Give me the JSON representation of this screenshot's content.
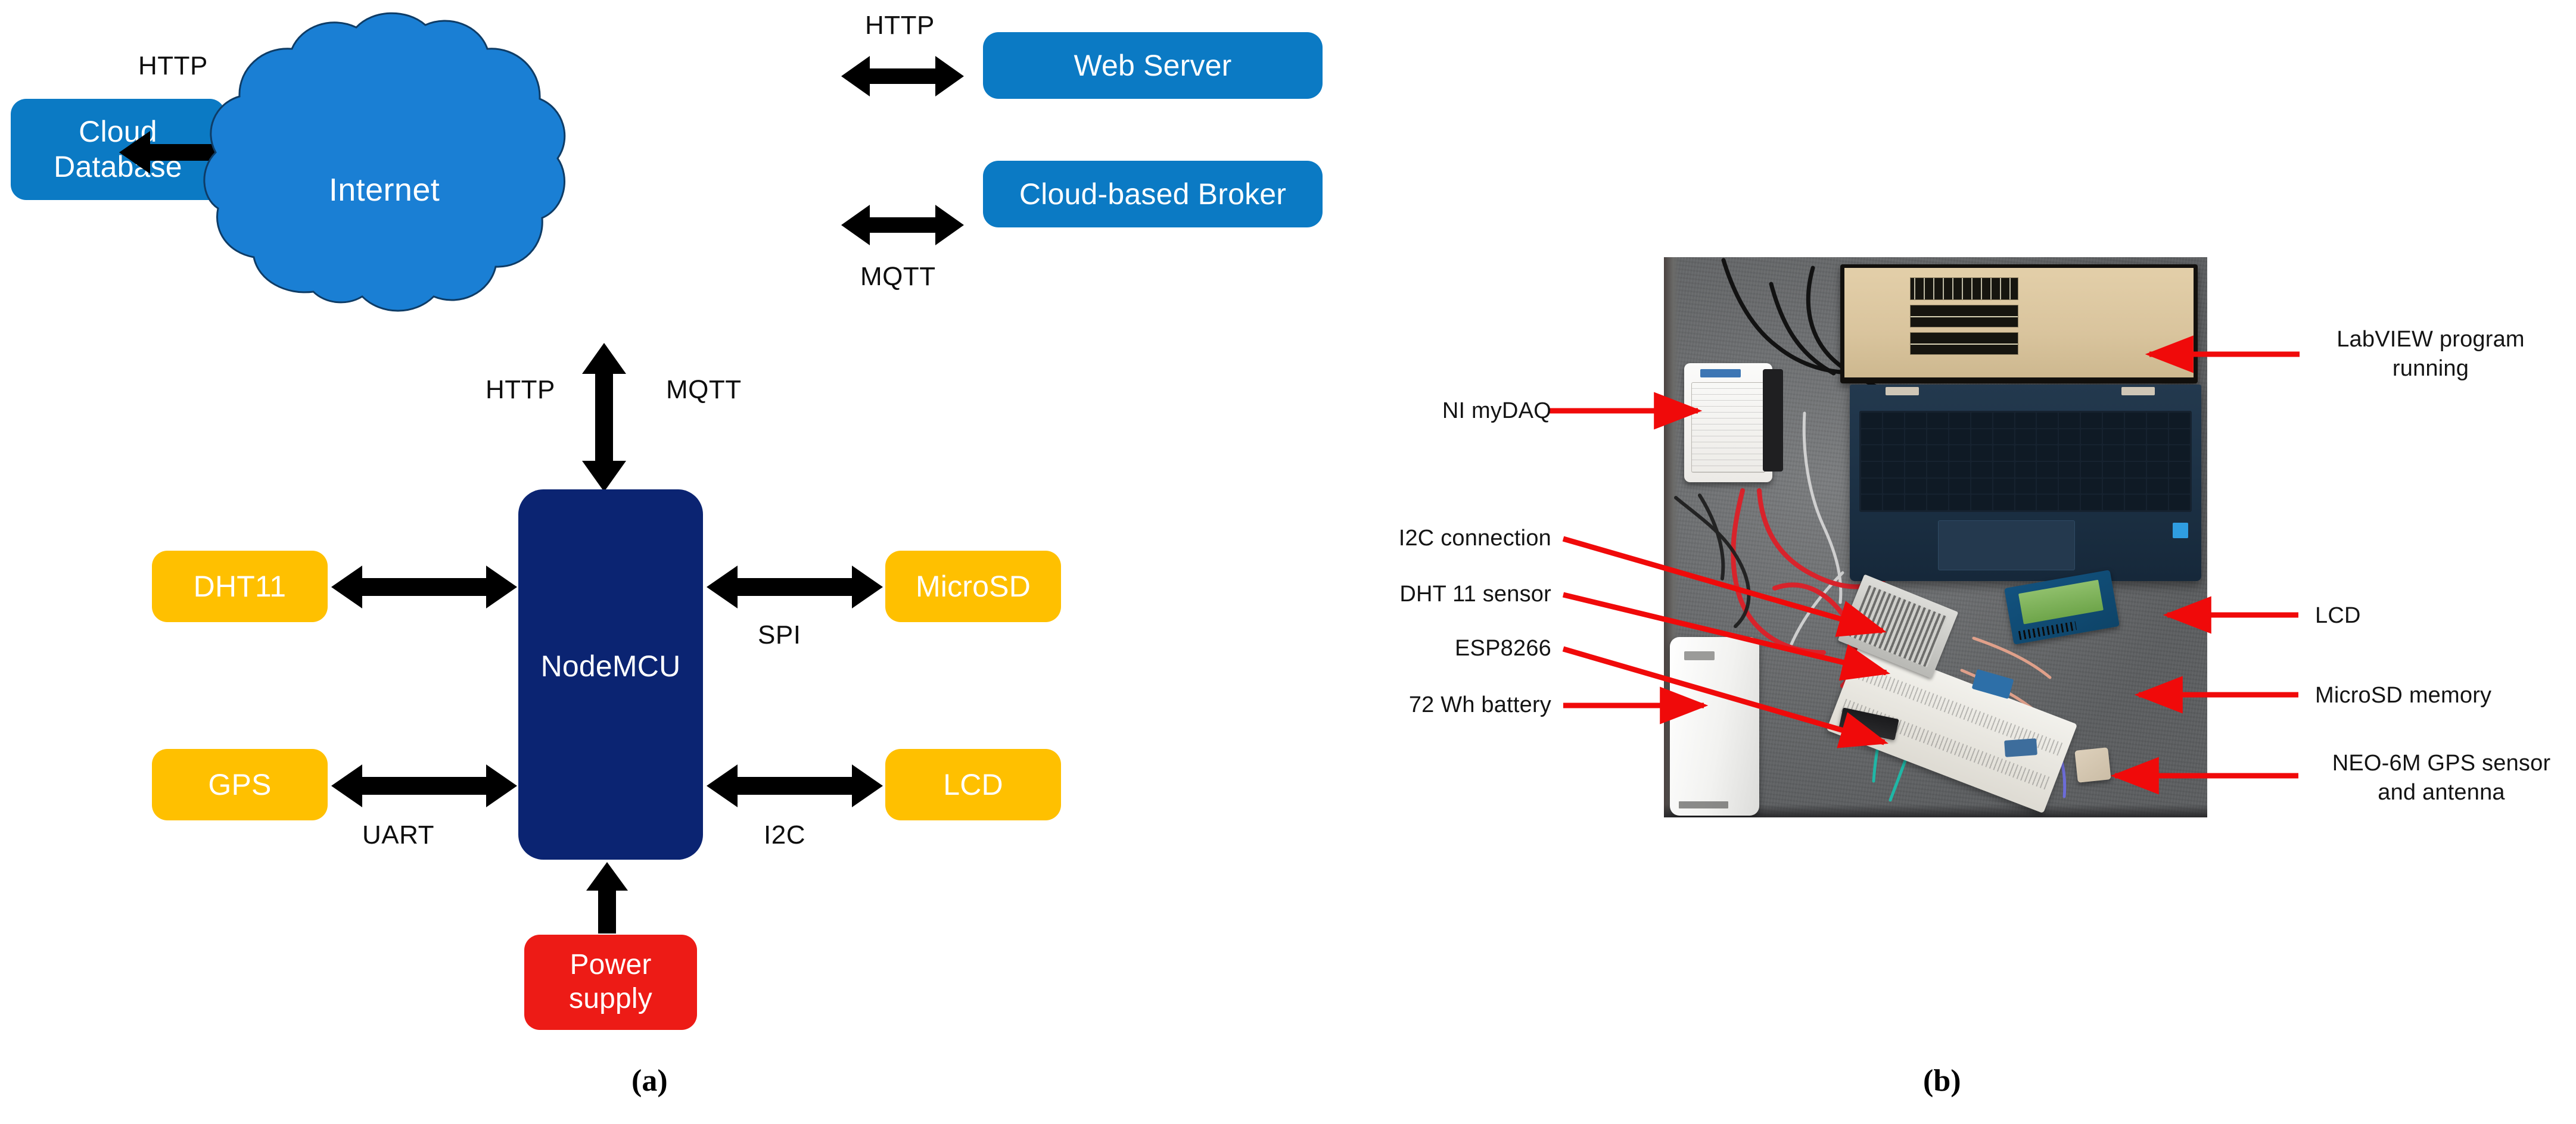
{
  "figure": {
    "panel_a_caption": "(a)",
    "panel_b_caption": "(b)"
  },
  "diagram": {
    "nodes": {
      "cloud_database": "Cloud\nDatabase",
      "cloud_database_line1": "Cloud",
      "cloud_database_line2": "Database",
      "internet": "Internet",
      "web_server": "Web Server",
      "cloud_broker": "Cloud-based Broker",
      "nodemcu": "NodeMCU",
      "dht11": "DHT11",
      "microsd": "MicroSD",
      "gps": "GPS",
      "lcd": "LCD",
      "power_supply_line1": "Power",
      "power_supply_line2": "supply"
    },
    "edge_labels": {
      "db_to_internet": "HTTP",
      "internet_to_web": "HTTP",
      "internet_to_broker": "MQTT",
      "down_http": "HTTP",
      "down_mqtt": "MQTT",
      "nodemcu_microsd": "SPI",
      "nodemcu_gps": "UART",
      "nodemcu_lcd": "I2C"
    },
    "colors": {
      "blue_box": "#0b7ac4",
      "yellow_box": "#ffc000",
      "red_box": "#ed1b16",
      "navy_box": "#0b2472",
      "arrow_black": "#000000"
    }
  },
  "photo": {
    "annotations": {
      "ni_mydaq": "NI myDAQ",
      "i2c_connection": "I2C connection",
      "dht11_sensor": "DHT 11 sensor",
      "esp8266": "ESP8266",
      "battery": "72 Wh battery",
      "labview": "LabVIEW program\nrunning",
      "lcd": "LCD",
      "microsd_memory": "MicroSD memory",
      "gps_sensor": "NEO-6M GPS sensor\nand antenna"
    },
    "arrow_color": "#f00a0a"
  }
}
